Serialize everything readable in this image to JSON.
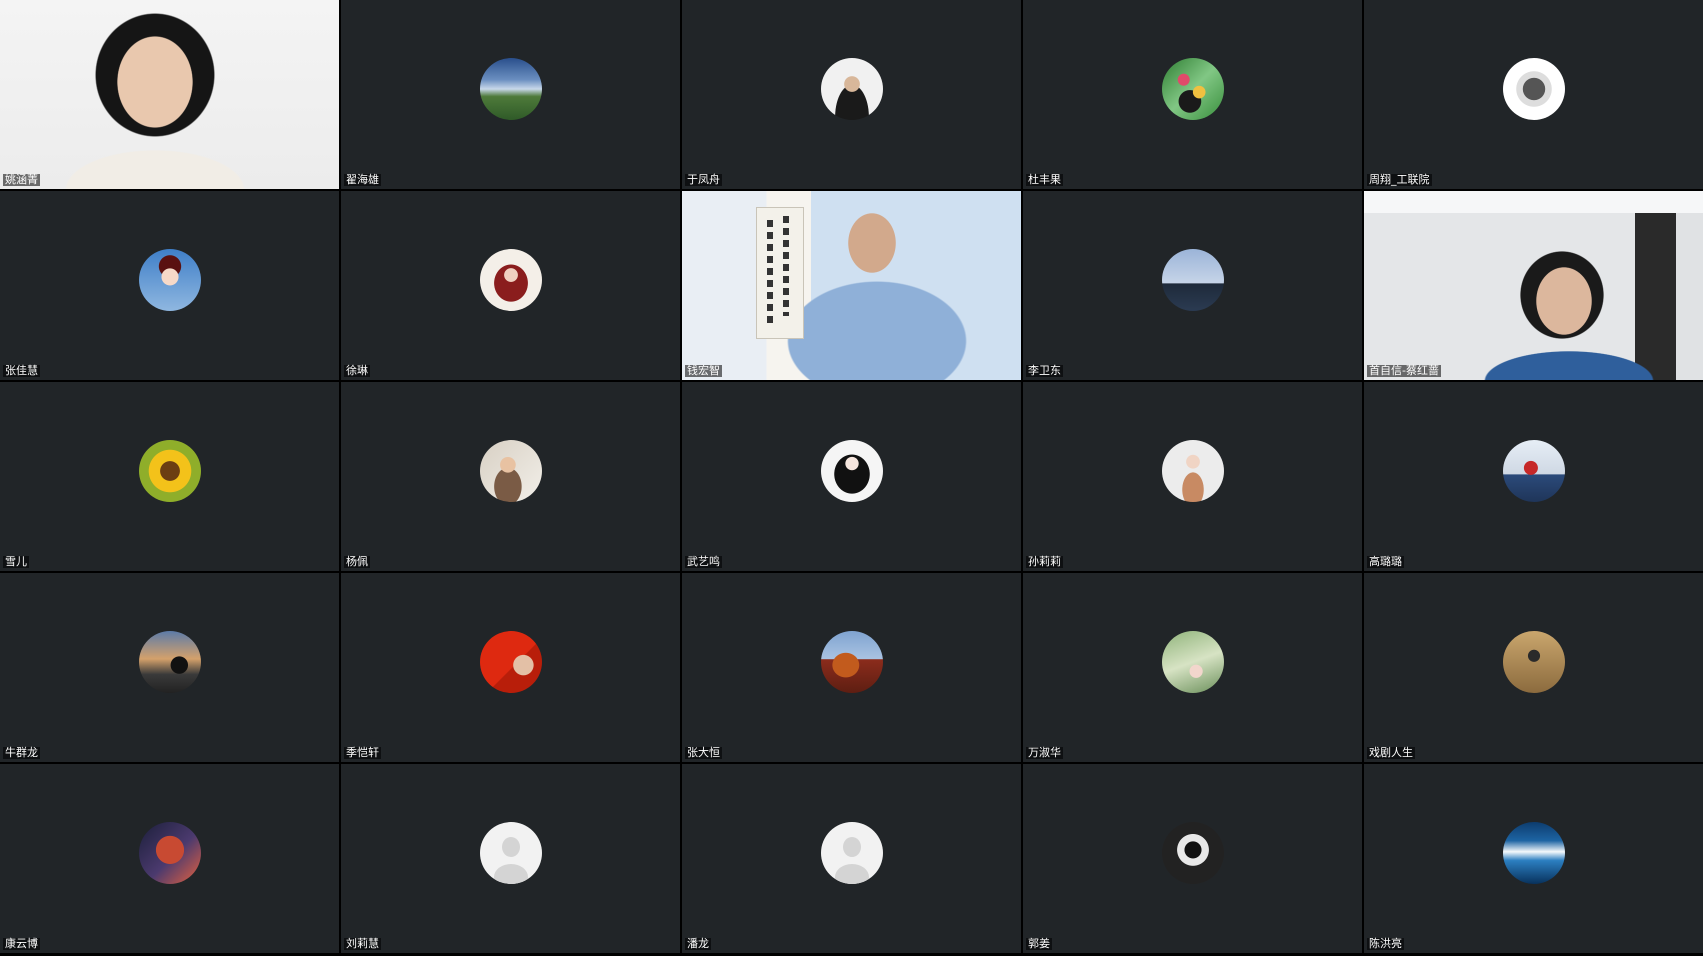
{
  "participants": [
    {
      "name": "姚涵菁",
      "type": "video",
      "style": "vid-woman"
    },
    {
      "name": "翟海雄",
      "type": "avatar",
      "style": "av-sky"
    },
    {
      "name": "于凤舟",
      "type": "avatar",
      "style": "av-man"
    },
    {
      "name": "杜丰果",
      "type": "avatar",
      "style": "av-flower"
    },
    {
      "name": "周翔_工联院",
      "type": "avatar",
      "style": "av-sketch"
    },
    {
      "name": "张佳慧",
      "type": "avatar",
      "style": "av-geisha"
    },
    {
      "name": "徐琳",
      "type": "avatar",
      "style": "av-redhair"
    },
    {
      "name": "钱宏智",
      "type": "video",
      "style": "vid-man"
    },
    {
      "name": "李卫东",
      "type": "avatar",
      "style": "av-ship"
    },
    {
      "name": "首自信-蔡红蔷",
      "type": "video",
      "style": "vid-woman2"
    },
    {
      "name": "雪儿",
      "type": "avatar",
      "style": "av-sunflower"
    },
    {
      "name": "杨佩",
      "type": "avatar",
      "style": "av-girl"
    },
    {
      "name": "武艺鸣",
      "type": "avatar",
      "style": "av-anime"
    },
    {
      "name": "孙莉莉",
      "type": "avatar",
      "style": "av-woman"
    },
    {
      "name": "高璐璐",
      "type": "avatar",
      "style": "av-scene"
    },
    {
      "name": "牛群龙",
      "type": "avatar",
      "style": "av-sunset"
    },
    {
      "name": "季恺轩",
      "type": "avatar",
      "style": "av-flag"
    },
    {
      "name": "张大恒",
      "type": "avatar",
      "style": "av-palace"
    },
    {
      "name": "万淑华",
      "type": "avatar",
      "style": "av-tree"
    },
    {
      "name": "戏剧人生",
      "type": "avatar",
      "style": "av-gold"
    },
    {
      "name": "康云博",
      "type": "avatar",
      "style": "av-moon"
    },
    {
      "name": "刘莉慧",
      "type": "avatar",
      "style": "av-default"
    },
    {
      "name": "潘龙",
      "type": "avatar",
      "style": "av-default"
    },
    {
      "name": "郭姜",
      "type": "avatar",
      "style": "av-astro"
    },
    {
      "name": "陈洪亮",
      "type": "avatar",
      "style": "av-wave"
    }
  ]
}
